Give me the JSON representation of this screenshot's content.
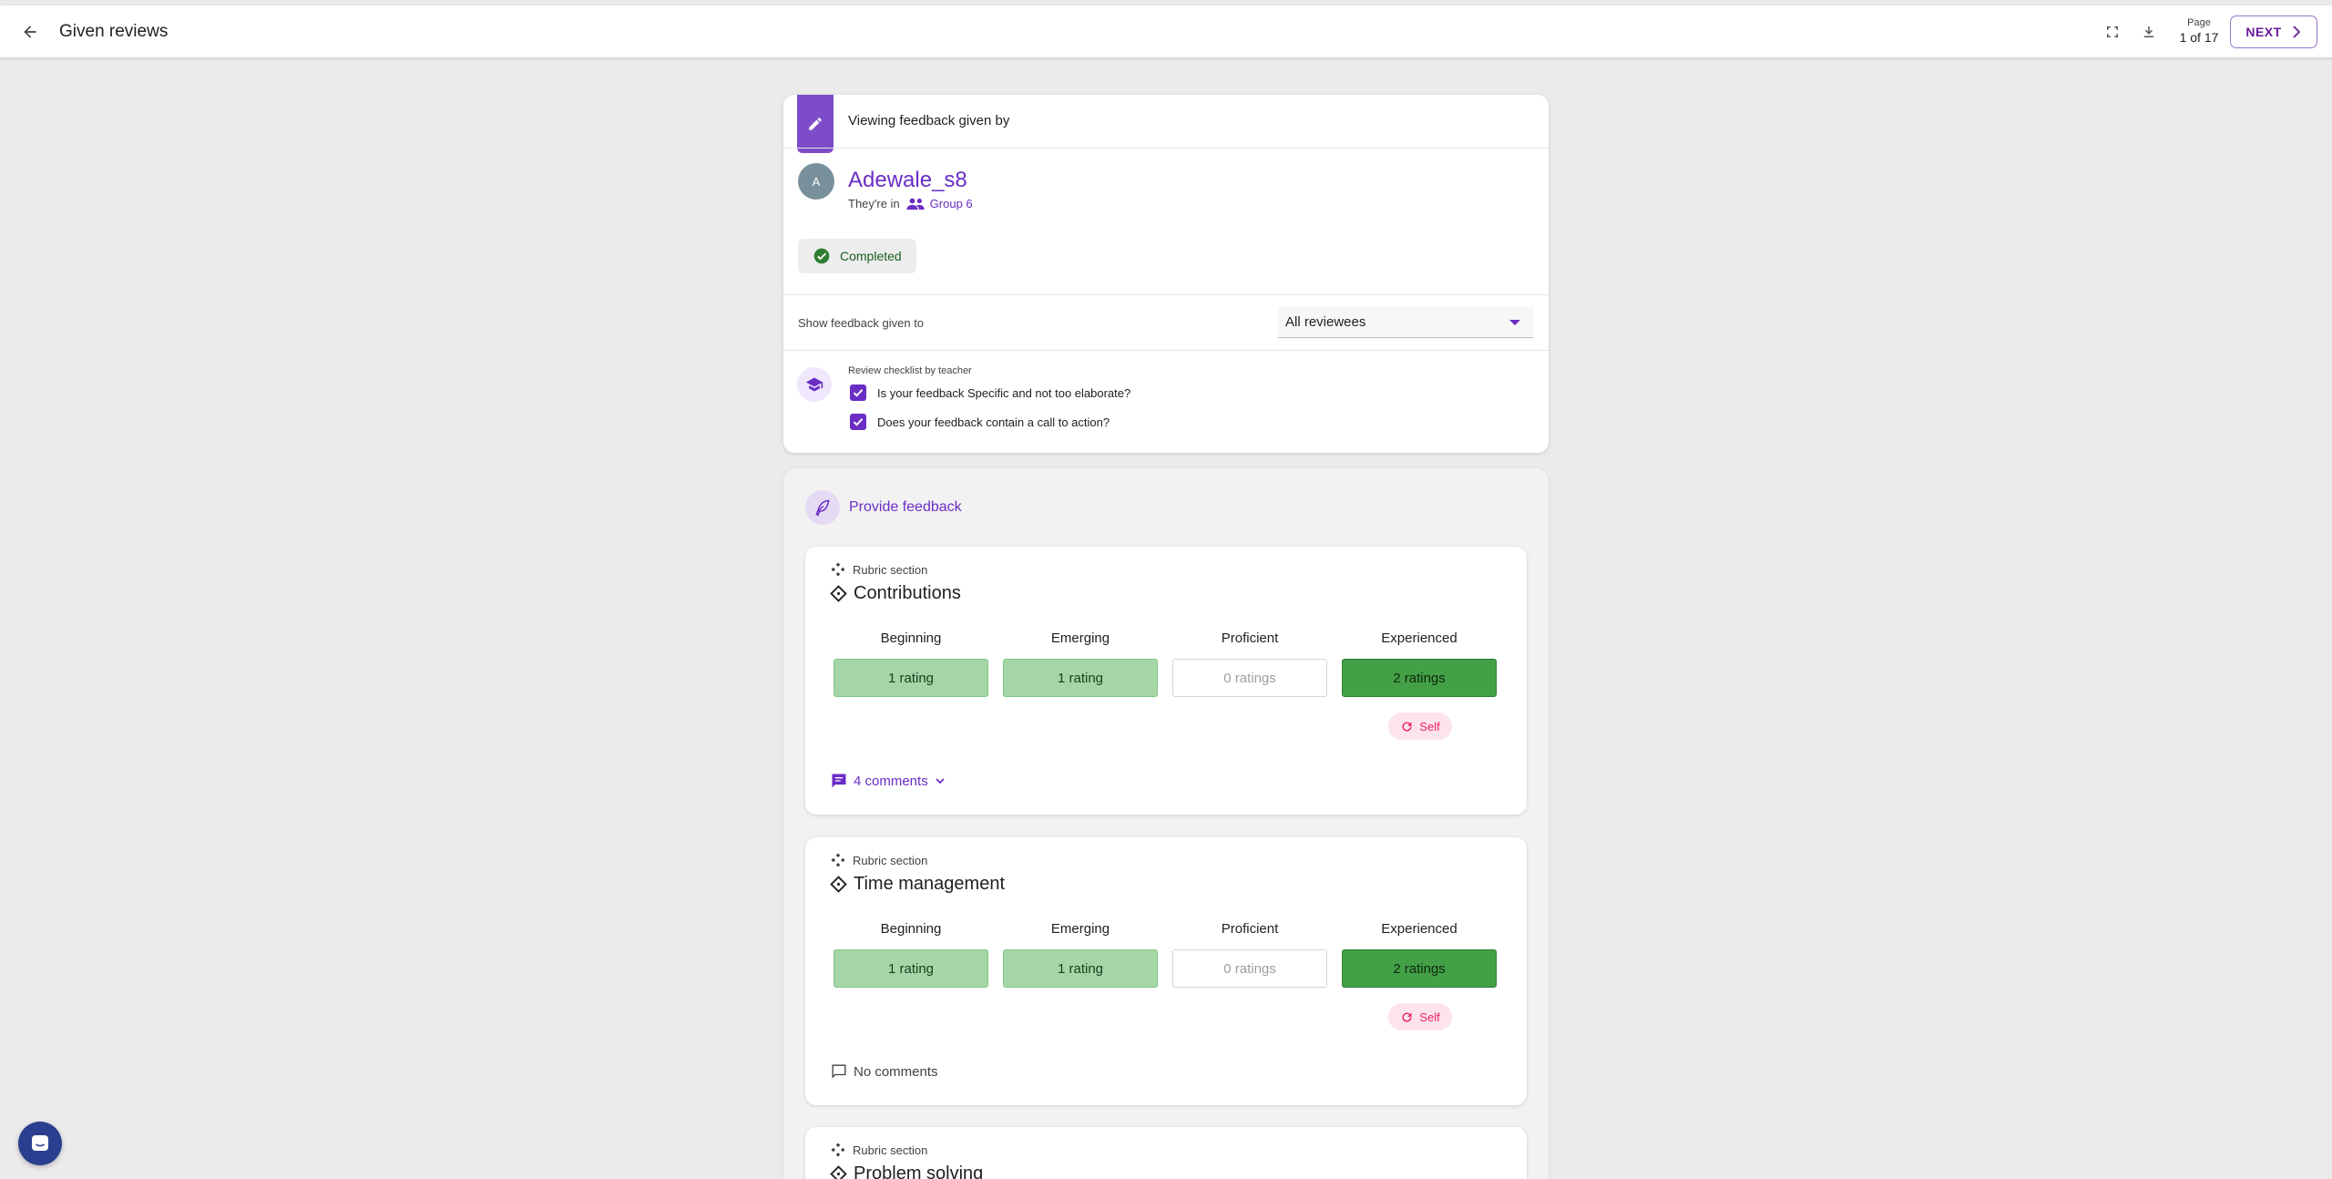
{
  "header": {
    "title": "Given reviews",
    "page_label": "Page",
    "page_value": "1 of 17",
    "next_label": "NEXT"
  },
  "reviewer": {
    "viewing_text": "Viewing feedback given by",
    "avatar_initial": "A",
    "name": "Adewale_s8",
    "in_prefix": "They're in",
    "group": "Group 6",
    "status": "Completed"
  },
  "filter": {
    "label": "Show feedback given to",
    "selected": "All reviewees"
  },
  "checklist": {
    "title": "Review checklist by teacher",
    "items": [
      "Is your feedback Specific and not too elaborate?",
      "Does your feedback contain a call to action?"
    ]
  },
  "feedback": {
    "heading": "Provide feedback",
    "section_label": "Rubric section",
    "level_names": [
      "Beginning",
      "Emerging",
      "Proficient",
      "Experienced"
    ],
    "sections": [
      {
        "title": "Contributions",
        "ratings": [
          "1 rating",
          "1 rating",
          "0 ratings",
          "2 ratings"
        ],
        "self_label": "Self",
        "comments": "4 comments"
      },
      {
        "title": "Time management",
        "ratings": [
          "1 rating",
          "1 rating",
          "0 ratings",
          "2 ratings"
        ],
        "self_label": "Self",
        "comments": "No comments"
      },
      {
        "title": "Problem solving"
      }
    ]
  },
  "colors": {
    "accent": "#6a2ec5",
    "rating_light": "#a5d6a7",
    "rating_dark": "#43a047",
    "self": "#e91e63"
  }
}
